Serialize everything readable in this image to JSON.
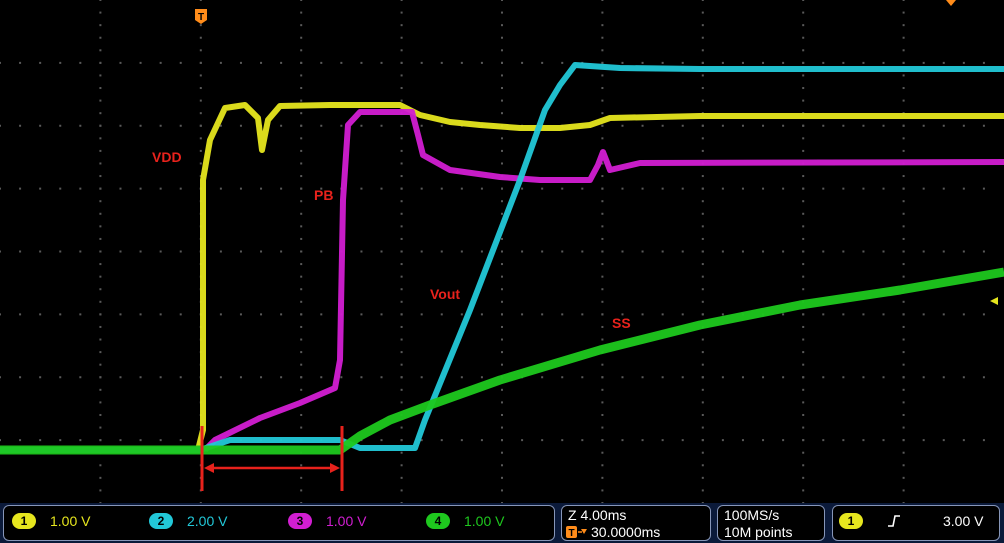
{
  "trace_labels": {
    "vdd": "VDD",
    "pb": "PB",
    "vout": "Vout",
    "ss": "SS"
  },
  "colors": {
    "ch1": "#e6e61e",
    "ch2": "#22c8d8",
    "ch3": "#d21ed2",
    "ch4": "#1ec81e",
    "annotation": "#e8221c",
    "trigger_marker": "#ff8c1a",
    "grid": "#5a5a5a"
  },
  "channels": [
    {
      "id": "1",
      "scale": "1.00 V",
      "color": "#e6e61e"
    },
    {
      "id": "2",
      "scale": "2.00 V",
      "color": "#22c8d8"
    },
    {
      "id": "3",
      "scale": "1.00 V",
      "color": "#d21ed2"
    },
    {
      "id": "4",
      "scale": "1.00 V",
      "color": "#1ec81e"
    }
  ],
  "timebase": {
    "zoom": "Z 4.00ms",
    "position": "30.0000ms"
  },
  "acquisition": {
    "sample_rate": "100MS/s",
    "record_length": "10M points"
  },
  "trigger": {
    "source": "1",
    "level": "3.00 V",
    "marker_letter": "T"
  }
}
